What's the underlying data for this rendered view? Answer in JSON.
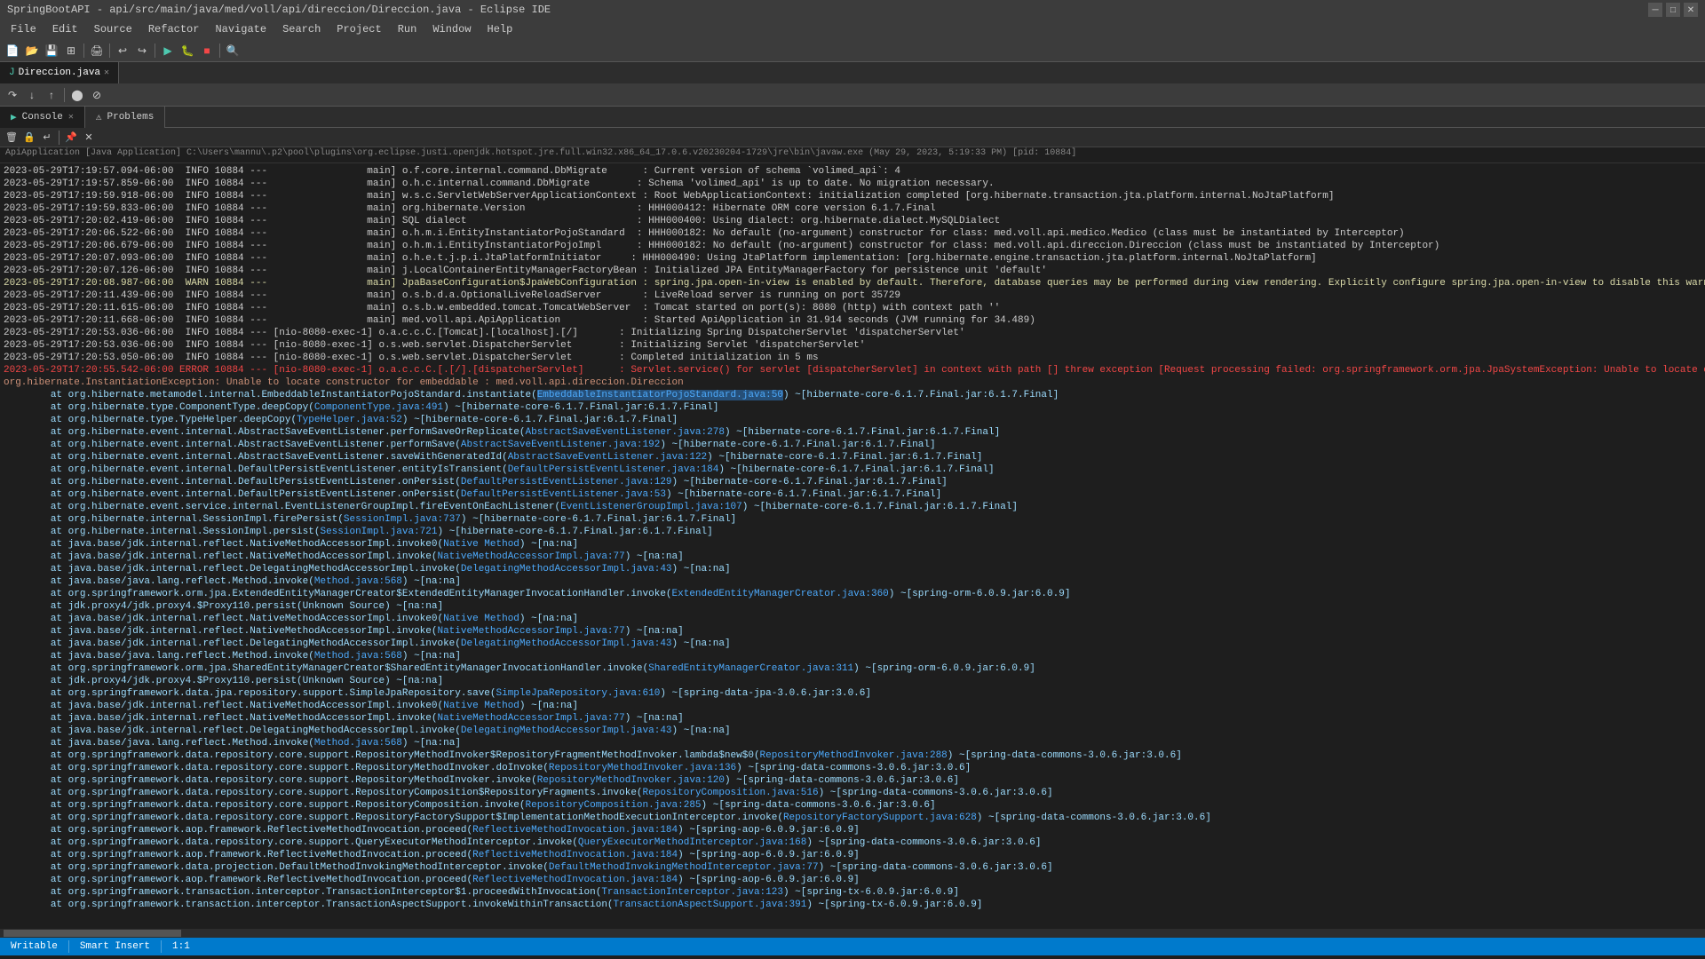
{
  "titleBar": {
    "title": "SpringBootAPI - api/src/main/java/med/voll/api/direccion/Direccion.java - Eclipse IDE",
    "controls": [
      "─",
      "□",
      "✕"
    ]
  },
  "menuBar": {
    "items": [
      "File",
      "Edit",
      "Source",
      "Refactor",
      "Navigate",
      "Search",
      "Project",
      "Run",
      "Window",
      "Help"
    ]
  },
  "consoleTabs": [
    {
      "label": "Console",
      "active": true,
      "closeable": true
    },
    {
      "label": "Problems",
      "active": false,
      "closeable": false
    }
  ],
  "infoBar": {
    "text": "ApiApplication [Java Application] C:\\Users\\mannu\\.p2\\pool\\plugins\\org.eclipse.justi.openjdk.hotspot.jre.full.win32.x86_64_17.0.6.v20230204-1729\\jre\\bin\\javaw.exe  (May 29, 2023, 5:19:33 PM) [pid: 10884]"
  },
  "logLines": [
    {
      "text": "2023-05-29T17:19:57.094-06:00  INFO 10884 ---                 main] o.f.core.internal.command.DbMigrate      : Current version of schema `volimed_api`: 4",
      "type": "info"
    },
    {
      "text": "2023-05-29T17:19:57.859-06:00  INFO 10884 ---                 main] o.h.c.internal.command.DbMigrate        : Schema 'volimed_api' is up to date. No migration necessary.",
      "type": "info"
    },
    {
      "text": "2023-05-29T17:19:59.918-06:00  INFO 10884 ---                 main] w.s.c.ServletWebServerApplicationContext : Root WebApplicationContext: initialization completed [org.hibernate.transaction.jta.platform.internal.NoJtaPlatform]",
      "type": "info"
    },
    {
      "text": "2023-05-29T17:19:59.833-06:00  INFO 10884 ---                 main] org.hibernate.Version                   : HHH000412: Hibernate ORM core version 6.1.7.Final",
      "type": "info"
    },
    {
      "text": "2023-05-29T17:20:02.419-06:00  INFO 10884 ---                 main] SQL dialect                             : HHH000400: Using dialect: org.hibernate.dialect.MySQLDialect",
      "type": "info"
    },
    {
      "text": "2023-05-29T17:20:06.522-06:00  INFO 10884 ---                 main] o.h.m.i.EntityInstantiatorPojoStandard  : HHH000182: No default (no-argument) constructor for class: med.voll.api.medico.Medico (class must be instantiated by Interceptor)",
      "type": "info"
    },
    {
      "text": "2023-05-29T17:20:06.679-06:00  INFO 10884 ---                 main] o.h.m.i.EntityInstantiatorPojoImpl      : HHH000182: No default (no-argument) constructor for class: med.voll.api.direccion.Direccion (class must be instantiated by Interceptor)",
      "type": "info"
    },
    {
      "text": "2023-05-29T17:20:07.093-06:00  INFO 10884 ---                 main] o.h.e.t.j.p.i.JtaPlatformInitiator     : HHH000490: Using JtaPlatform implementation: [org.hibernate.engine.transaction.jta.platform.internal.NoJtaPlatform]",
      "type": "info"
    },
    {
      "text": "2023-05-29T17:20:07.126-06:00  INFO 10884 ---                 main] j.LocalContainerEntityManagerFactoryBean : Initialized JPA EntityManagerFactory for persistence unit 'default'",
      "type": "info"
    },
    {
      "text": "2023-05-29T17:20:08.987-06:00  WARN 10884 ---                 main] JpaBaseConfiguration$JpaWebConfiguration : spring.jpa.open-in-view is enabled by default. Therefore, database queries may be performed during view rendering. Explicitly configure spring.jpa.open-in-view to disable this warning",
      "type": "warn"
    },
    {
      "text": "2023-05-29T17:20:11.439-06:00  INFO 10884 ---                 main] o.s.b.d.a.OptionalLiveReloadServer       : LiveReload server is running on port 35729",
      "type": "info"
    },
    {
      "text": "2023-05-29T17:20:11.615-06:00  INFO 10884 ---                 main] o.s.b.w.embedded.tomcat.TomcatWebServer  : Tomcat started on port(s): 8080 (http) with context path ''",
      "type": "info"
    },
    {
      "text": "2023-05-29T17:20:11.668-06:00  INFO 10884 ---                 main] med.voll.api.ApiApplication              : Started ApiApplication in 31.914 seconds (JVM running for 34.489)",
      "type": "info"
    },
    {
      "text": "2023-05-29T17:20:53.036-06:00  INFO 10884 --- [nio-8080-exec-1] o.a.c.c.C.[Tomcat].[localhost].[/]       : Initializing Spring DispatcherServlet 'dispatcherServlet'",
      "type": "info"
    },
    {
      "text": "2023-05-29T17:20:53.036-06:00  INFO 10884 --- [nio-8080-exec-1] o.s.web.servlet.DispatcherServlet        : Initializing Servlet 'dispatcherServlet'",
      "type": "info"
    },
    {
      "text": "2023-05-29T17:20:53.050-06:00  INFO 10884 --- [nio-8080-exec-1] o.s.web.servlet.DispatcherServlet        : Completed initialization in 5 ms",
      "type": "info"
    },
    {
      "text": "2023-05-29T17:20:55.542-06:00 ERROR 10884 --- [nio-8080-exec-1] o.a.c.c.C.[.[/].[dispatcherServlet]      : Servlet.service() for servlet [dispatcherServlet] in context with path [] threw exception [Request processing failed: org.springframework.orm.jpa.JpaSystemException: Unable to locate constructor for embeddable: med.voll.api.direccion.Direccion] with root cause",
      "type": "error"
    },
    {
      "text": "",
      "type": "info"
    },
    {
      "text": "org.hibernate.InstantiationException: Unable to locate constructor for embeddable : med.voll.api.direccion.Direccion",
      "type": "exception"
    },
    {
      "text": "\tat org.hibernate.metamodel.internal.EmbeddableInstantiatorPojoStandard.instantiate(EmbeddableInstantiatorPojoStandard.java:50) ~[hibernate-core-6.1.7.Final.jar:6.1.7.Final]",
      "type": "stack",
      "hasLink": true,
      "linkText": "EmbeddableInstantiatorPojoStandard.java:50",
      "linkHighlight": true
    },
    {
      "text": "\tat org.hibernate.type.ComponentType.deepCopy(ComponentType.java:491) ~[hibernate-core-6.1.7.Final.jar:6.1.7.Final]",
      "type": "stack",
      "hasLink": true,
      "linkText": "ComponentType.java:491"
    },
    {
      "text": "\tat org.hibernate.type.TypeHelper.deepCopy(TypeHelper.java:52) ~[hibernate-core-6.1.7.Final.jar:6.1.7.Final]",
      "type": "stack",
      "hasLink": true,
      "linkText": "TypeHelper.java:52"
    },
    {
      "text": "\tat org.hibernate.event.internal.AbstractSaveEventListener.performSaveOrReplicate(AbstractSaveEventListener.java:278) ~[hibernate-core-6.1.7.Final.jar:6.1.7.Final]",
      "type": "stack",
      "hasLink": true,
      "linkText": "AbstractSaveEventListener.java:278"
    },
    {
      "text": "\tat org.hibernate.event.internal.AbstractSaveEventListener.performSave(AbstractSaveEventListener.java:192) ~[hibernate-core-6.1.7.Final.jar:6.1.7.Final]",
      "type": "stack",
      "hasLink": true,
      "linkText": "AbstractSaveEventListener.java:192"
    },
    {
      "text": "\tat org.hibernate.event.internal.AbstractSaveEventListener.saveWithGeneratedId(AbstractSaveEventListener.java:122) ~[hibernate-core-6.1.7.Final.jar:6.1.7.Final]",
      "type": "stack",
      "hasLink": true,
      "linkText": "AbstractSaveEventListener.java:122"
    },
    {
      "text": "\tat org.hibernate.event.internal.DefaultPersistEventListener.entityIsTransient(DefaultPersistEventListener.java:184) ~[hibernate-core-6.1.7.Final.jar:6.1.7.Final]",
      "type": "stack",
      "hasLink": true,
      "linkText": "DefaultPersistEventListener.java:184"
    },
    {
      "text": "\tat org.hibernate.event.internal.DefaultPersistEventListener.onPersist(DefaultPersistEventListener.java:129) ~[hibernate-core-6.1.7.Final.jar:6.1.7.Final]",
      "type": "stack",
      "hasLink": true,
      "linkText": "DefaultPersistEventListener.java:129"
    },
    {
      "text": "\tat org.hibernate.event.internal.DefaultPersistEventListener.onPersist(DefaultPersistEventListener.java:53) ~[hibernate-core-6.1.7.Final.jar:6.1.7.Final]",
      "type": "stack",
      "hasLink": true,
      "linkText": "DefaultPersistEventListener.java:53"
    },
    {
      "text": "\tat org.hibernate.event.service.internal.EventListenerGroupImpl.fireEventOnEachListener(EventListenerGroupImpl.java:107) ~[hibernate-core-6.1.7.Final.jar:6.1.7.Final]",
      "type": "stack",
      "hasLink": true,
      "linkText": "EventListenerGroupImpl.java:107"
    },
    {
      "text": "\tat org.hibernate.internal.SessionImpl.firePersist(SessionImpl.java:737) ~[hibernate-core-6.1.7.Final.jar:6.1.7.Final]",
      "type": "stack",
      "hasLink": true,
      "linkText": "SessionImpl.java:737"
    },
    {
      "text": "\tat org.hibernate.internal.SessionImpl.persist(SessionImpl.java:721) ~[hibernate-core-6.1.7.Final.jar:6.1.7.Final]",
      "type": "stack",
      "hasLink": true,
      "linkText": "SessionImpl.java:721"
    },
    {
      "text": "\tat java.base/jdk.internal.reflect.NativeMethodAccessorImpl.invoke0(Native Method) ~[na:na]",
      "type": "stack",
      "hasLink": true,
      "linkText": "Native Method"
    },
    {
      "text": "\tat java.base/jdk.internal.reflect.NativeMethodAccessorImpl.invoke(NativeMethodAccessorImpl.java:77) ~[na:na]",
      "type": "stack",
      "hasLink": true,
      "linkText": "NativeMethodAccessorImpl.java:77"
    },
    {
      "text": "\tat java.base/jdk.internal.reflect.DelegatingMethodAccessorImpl.invoke(DelegatingMethodAccessorImpl.java:43) ~[na:na]",
      "type": "stack",
      "hasLink": true,
      "linkText": "DelegatingMethodAccessorImpl.java:43"
    },
    {
      "text": "\tat java.base/java.lang.reflect.Method.invoke(Method.java:568) ~[na:na]",
      "type": "stack",
      "hasLink": true,
      "linkText": "Method.java:568"
    },
    {
      "text": "\tat org.springframework.orm.jpa.ExtendedEntityManagerCreator$ExtendedEntityManagerInvocationHandler.invoke(ExtendedEntityManagerCreator.java:360) ~[spring-orm-6.0.9.jar:6.0.9]",
      "type": "stack",
      "hasLink": true,
      "linkText": "ExtendedEntityManagerCreator.java:360"
    },
    {
      "text": "\tat jdk.proxy4/jdk.proxy4.$Proxy110.persist(Unknown Source) ~[na:na]",
      "type": "stack"
    },
    {
      "text": "\tat java.base/jdk.internal.reflect.NativeMethodAccessorImpl.invoke0(Native Method) ~[na:na]",
      "type": "stack",
      "hasLink": true,
      "linkText": "Native Method"
    },
    {
      "text": "\tat java.base/jdk.internal.reflect.NativeMethodAccessorImpl.invoke(NativeMethodAccessorImpl.java:77) ~[na:na]",
      "type": "stack",
      "hasLink": true,
      "linkText": "NativeMethodAccessorImpl.java:77"
    },
    {
      "text": "\tat java.base/jdk.internal.reflect.DelegatingMethodAccessorImpl.invoke(DelegatingMethodAccessorImpl.java:43) ~[na:na]",
      "type": "stack",
      "hasLink": true,
      "linkText": "DelegatingMethodAccessorImpl.java:43"
    },
    {
      "text": "\tat java.base/java.lang.reflect.Method.invoke(Method.java:568) ~[na:na]",
      "type": "stack",
      "hasLink": true,
      "linkText": "Method.java:568"
    },
    {
      "text": "\tat org.springframework.orm.jpa.SharedEntityManagerCreator$SharedEntityManagerInvocationHandler.invoke(SharedEntityManagerCreator.java:311) ~[spring-orm-6.0.9.jar:6.0.9]",
      "type": "stack",
      "hasLink": true,
      "linkText": "SharedEntityManagerCreator.java:311"
    },
    {
      "text": "\tat jdk.proxy4/jdk.proxy4.$Proxy110.persist(Unknown Source) ~[na:na]",
      "type": "stack"
    },
    {
      "text": "\tat org.springframework.data.jpa.repository.support.SimpleJpaRepository.save(SimpleJpaRepository.java:610) ~[spring-data-jpa-3.0.6.jar:3.0.6]",
      "type": "stack",
      "hasLink": true,
      "linkText": "SimpleJpaRepository.java:610"
    },
    {
      "text": "\tat java.base/jdk.internal.reflect.NativeMethodAccessorImpl.invoke0(Native Method) ~[na:na]",
      "type": "stack",
      "hasLink": true,
      "linkText": "Native Method"
    },
    {
      "text": "\tat java.base/jdk.internal.reflect.NativeMethodAccessorImpl.invoke(NativeMethodAccessorImpl.java:77) ~[na:na]",
      "type": "stack",
      "hasLink": true,
      "linkText": "NativeMethodAccessorImpl.java:77"
    },
    {
      "text": "\tat java.base/jdk.internal.reflect.DelegatingMethodAccessorImpl.invoke(DelegatingMethodAccessorImpl.java:43) ~[na:na]",
      "type": "stack",
      "hasLink": true,
      "linkText": "DelegatingMethodAccessorImpl.java:43"
    },
    {
      "text": "\tat java.base/java.lang.reflect.Method.invoke(Method.java:568) ~[na:na]",
      "type": "stack",
      "hasLink": true,
      "linkText": "Method.java:568"
    },
    {
      "text": "\tat org.springframework.data.repository.core.support.RepositoryMethodInvoker$RepositoryFragmentMethodInvoker.lambda$new$0(RepositoryMethodInvoker.java:288) ~[spring-data-commons-3.0.6.jar:3.0.6]",
      "type": "stack",
      "hasLink": true,
      "linkText": "RepositoryMethodInvoker.java:288"
    },
    {
      "text": "\tat org.springframework.data.repository.core.support.RepositoryMethodInvoker.doInvoke(RepositoryMethodInvoker.java:136) ~[spring-data-commons-3.0.6.jar:3.0.6]",
      "type": "stack",
      "hasLink": true,
      "linkText": "RepositoryMethodInvoker.java:136"
    },
    {
      "text": "\tat org.springframework.data.repository.core.support.RepositoryMethodInvoker.invoke(RepositoryMethodInvoker.java:120) ~[spring-data-commons-3.0.6.jar:3.0.6]",
      "type": "stack",
      "hasLink": true,
      "linkText": "RepositoryMethodInvoker.java:120"
    },
    {
      "text": "\tat org.springframework.data.repository.core.support.RepositoryComposition$RepositoryFragments.invoke(RepositoryComposition.java:516) ~[spring-data-commons-3.0.6.jar:3.0.6]",
      "type": "stack",
      "hasLink": true,
      "linkText": "RepositoryComposition.java:516"
    },
    {
      "text": "\tat org.springframework.data.repository.core.support.RepositoryComposition.invoke(RepositoryComposition.java:285) ~[spring-data-commons-3.0.6.jar:3.0.6]",
      "type": "stack",
      "hasLink": true,
      "linkText": "RepositoryComposition.java:285"
    },
    {
      "text": "\tat org.springframework.data.repository.core.support.RepositoryFactorySupport$ImplementationMethodExecutionInterceptor.invoke(RepositoryFactorySupport.java:628) ~[spring-data-commons-3.0.6.jar:3.0.6]",
      "type": "stack",
      "hasLink": true,
      "linkText": "RepositoryFactorySupport.java:628"
    },
    {
      "text": "\tat org.springframework.aop.framework.ReflectiveMethodInvocation.proceed(ReflectiveMethodInvocation.java:184) ~[spring-aop-6.0.9.jar:6.0.9]",
      "type": "stack",
      "hasLink": true,
      "linkText": "ReflectiveMethodInvocation.java:184"
    },
    {
      "text": "\tat org.springframework.data.repository.core.support.QueryExecutorMethodInterceptor.invoke(QueryExecutorMethodInterceptor.java:168) ~[spring-data-commons-3.0.6.jar:3.0.6]",
      "type": "stack",
      "hasLink": true,
      "linkText": "QueryExecutorMethodInterceptor.java:168"
    },
    {
      "text": "\tat org.springframework.aop.framework.ReflectiveMethodInvocation.proceed(ReflectiveMethodInvocation.java:184) ~[spring-aop-6.0.9.jar:6.0.9]",
      "type": "stack",
      "hasLink": true,
      "linkText": "ReflectiveMethodInvocation.java:184"
    },
    {
      "text": "\tat org.springframework.data.projection.DefaultMethodInvokingMethodInterceptor.invoke(DefaultMethodInvokingMethodInterceptor.java:77) ~[spring-data-commons-3.0.6.jar:3.0.6]",
      "type": "stack",
      "hasLink": true,
      "linkText": "DefaultMethodInvokingMethodInterceptor.java:77"
    },
    {
      "text": "\tat org.springframework.aop.framework.ReflectiveMethodInvocation.proceed(ReflectiveMethodInvocation.java:184) ~[spring-aop-6.0.9.jar:6.0.9]",
      "type": "stack",
      "hasLink": true,
      "linkText": "ReflectiveMethodInvocation.java:184"
    },
    {
      "text": "\tat org.springframework.transaction.interceptor.TransactionInterceptor$1.proceedWithInvocation(TransactionInterceptor.java:123) ~[spring-tx-6.0.9.jar:6.0.9]",
      "type": "stack",
      "hasLink": true,
      "linkText": "TransactionInterceptor.java:123"
    },
    {
      "text": "\tat org.springframework.transaction.interceptor.TransactionAspectSupport.invokeWithinTransaction(TransactionAspectSupport.java:391) ~[spring-tx-6.0.9.jar:6.0.9]",
      "type": "stack",
      "hasLink": true,
      "linkText": "TransactionAspectSupport.java:391"
    }
  ],
  "statusBar": {
    "items": [
      "Writable",
      "Smart Insert",
      "1:1"
    ]
  }
}
